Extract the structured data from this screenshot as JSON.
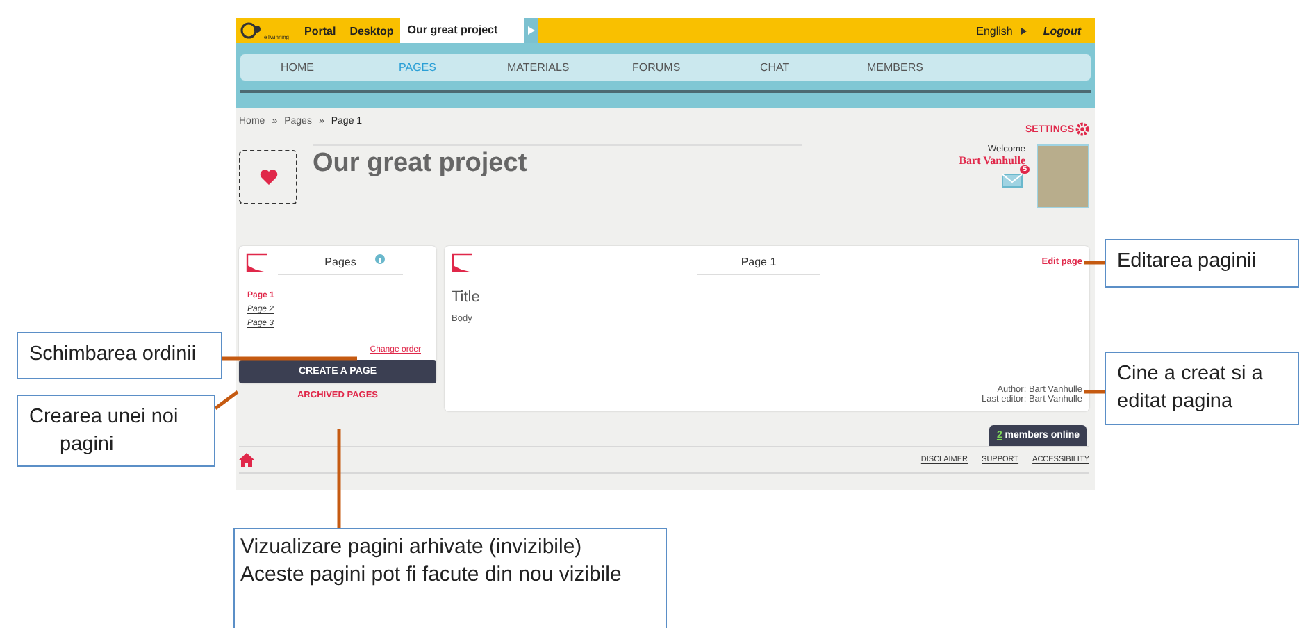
{
  "top_bar": {
    "logo_text": "eTwinning",
    "links": [
      "Portal",
      "Desktop"
    ],
    "project_tab": "Our great project",
    "language": "English",
    "logout": "Logout"
  },
  "nav": [
    {
      "label": "HOME",
      "selected": false
    },
    {
      "label": "PAGES",
      "selected": true
    },
    {
      "label": "MATERIALS",
      "selected": false
    },
    {
      "label": "FORUMS",
      "selected": false
    },
    {
      "label": "CHAT",
      "selected": false
    },
    {
      "label": "MEMBERS",
      "selected": false
    }
  ],
  "breadcrumb": {
    "items": [
      "Home",
      "Pages",
      "Page 1"
    ],
    "separator": "»"
  },
  "settings": "SETTINGS",
  "project_title": "Our great project",
  "user": {
    "welcome": "Welcome",
    "name": "Bart Vanhulle",
    "message_count": "5"
  },
  "pages_panel": {
    "title": "Pages",
    "pages": [
      {
        "label": "Page 1",
        "selected": true
      },
      {
        "label": "Page 2",
        "selected": false
      },
      {
        "label": "Page 3",
        "selected": false
      }
    ],
    "change_order": "Change order",
    "create_button": "CREATE A PAGE",
    "archived": "ARCHIVED PAGES"
  },
  "page_panel": {
    "title": "Page 1",
    "edit": "Edit page",
    "content_title": "Title",
    "body": "Body",
    "author": "Author: Bart Vanhulle",
    "last_editor": "Last editor: Bart Vanhulle"
  },
  "online": {
    "count": "2",
    "label": "members online"
  },
  "footer_links": [
    "DISCLAIMER",
    "SUPPORT",
    "ACCESSIBILITY"
  ],
  "annotations": [
    {
      "lines": [
        "Editarea paginii"
      ]
    },
    {
      "lines": [
        "Schimbarea ordinii"
      ]
    },
    {
      "lines": [
        "Crearea unei noi",
        "pagini"
      ]
    },
    {
      "lines": [
        "Cine a creat si a editat pagina"
      ]
    },
    {
      "lines": [
        "Vizualizare pagini arhivate (invizibile)",
        "Aceste pagini pot fi facute din nou vizibile"
      ]
    }
  ]
}
